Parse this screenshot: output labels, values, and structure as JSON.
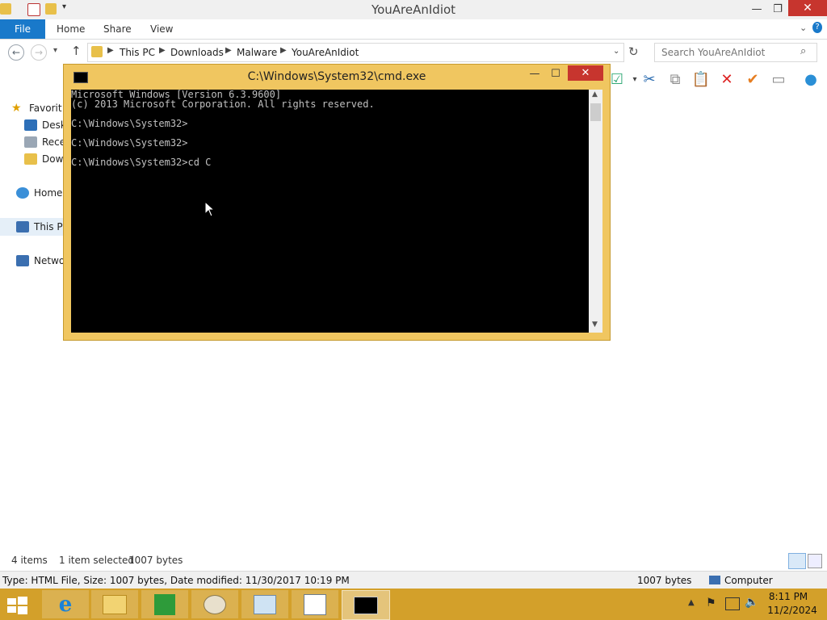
{
  "explorer": {
    "window_title": "YouAreAnIdiot",
    "tabs": [
      "File",
      "Home",
      "Share",
      "View"
    ],
    "breadcrumb": [
      "This PC",
      "Downloads",
      "Malware",
      "YouAreAnIdiot"
    ],
    "search_placeholder": "Search YouAreAnIdiot",
    "nav": {
      "favorites": "Favorit",
      "desktop": "Deskt",
      "recent": "Recer",
      "downloads": "Dowr",
      "homegroup": "Homeg",
      "thispc": "This PC",
      "network": "Netwo"
    },
    "status": {
      "items": "4 items",
      "selected": "1 item selected",
      "size": "1007 bytes"
    },
    "details": {
      "info": "Type: HTML File, Size: 1007 bytes, Date modified: 11/30/2017 10:19 PM",
      "size": "1007 bytes",
      "location": "Computer"
    }
  },
  "cmd": {
    "title": "C:\\Windows\\System32\\cmd.exe",
    "lines": [
      "Microsoft Windows [Version 6.3.9600]",
      "(c) 2013 Microsoft Corporation. All rights reserved.",
      "",
      "C:\\Windows\\System32>",
      "",
      "C:\\Windows\\System32>",
      "",
      "C:\\Windows\\System32>cd C"
    ]
  },
  "taskbar": {
    "time": "8:11 PM",
    "date": "11/2/2024"
  },
  "colors": {
    "file_tab": "#1979ca",
    "window_frame": "#f0c660",
    "taskbar": "#d3a02a",
    "close_button": "#c7352e",
    "console_bg": "#000000"
  },
  "icons": [
    "folder-icon",
    "undo-icon",
    "dropdown-icon",
    "back-icon",
    "forward-icon",
    "up-icon",
    "refresh-icon",
    "search-icon",
    "cut-icon",
    "copy-icon",
    "paste-icon",
    "delete-icon",
    "checkmark-icon",
    "rename-icon",
    "globe-icon",
    "start-icon",
    "ie-icon",
    "file-explorer-icon",
    "store-icon",
    "paint-icon",
    "task-manager-icon",
    "notepad-icon",
    "cmd-icon",
    "flag-icon",
    "network-icon",
    "volume-icon"
  ]
}
